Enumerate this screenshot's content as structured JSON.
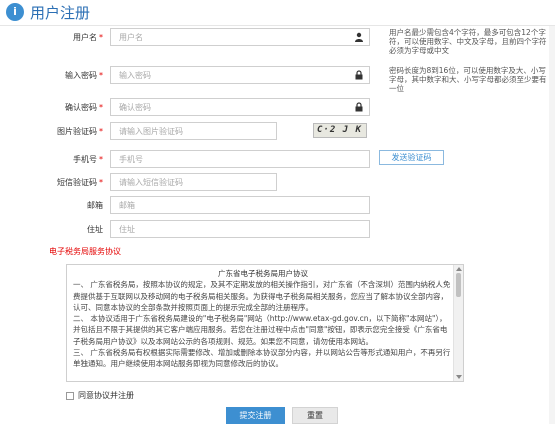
{
  "header": {
    "title": "用户注册",
    "logo_char": "i"
  },
  "fields": {
    "username": {
      "label": "用户名",
      "placeholder": "用户名",
      "required": "*"
    },
    "password": {
      "label": "输入密码",
      "placeholder": "输入密码",
      "required": "*"
    },
    "confirm": {
      "label": "确认密码",
      "placeholder": "确认密码",
      "required": "*"
    },
    "captcha": {
      "label": "图片验证码",
      "placeholder": "请输入图片验证码",
      "required": "*",
      "image_text": "C·2 J K"
    },
    "phone": {
      "label": "手机号",
      "placeholder": "手机号",
      "required": "*"
    },
    "sms": {
      "label": "短信验证码",
      "placeholder": "请输入短信验证码",
      "required": "*"
    },
    "email": {
      "label": "邮箱",
      "placeholder": "邮箱"
    },
    "address": {
      "label": "住址",
      "placeholder": "住址"
    }
  },
  "hints": {
    "username": "用户名最少需包含4个字符，最多可包含12个字符，可以使用数字、中文及字母，且前四个字符必须为字母或中文",
    "password": "密码长度为8到16位，可以使用数字及大、小写字母，其中数字和大、小写字母都必须至少要有一位"
  },
  "sms_button": "发送验证码",
  "agreement": {
    "section_title": "电子税务局服务协议",
    "doc_title": "广东省电子税务局用户协议",
    "paragraphs": [
      "一、 广东省税务局，按照本协议的规定，及其不定期发放的相关操作指引，对广东省（不含深圳）范围内纳税人免费提供基于互联网以及移动网的电子税务局相关服务。为获得电子税务局相关服务，您应当了解本协议全部内容，认可、同意本协议的全部条款并按照页面上的提示完成全部的注册程序。",
      "二、 本协议适用于广东省税务局建设的\"电子税务局\"网站（http://www.etax-gd.gov.cn，以下简称\"本网站\"），并包括且不限于其提供的其它客户端应用服务。若您在注册过程中点击\"同意\"按钮，即表示您完全接受《广东省电子税务局用户协议》以及本网站公示的各项规则、规范。如果您不同意，请勿使用本网站。",
      "三、 广东省税务局有权根据实际需要修改、增加或删除本协议部分内容，并以网站公告等形式通知用户，不再另行单独通知。用户继续使用本网站服务即视为同意修改后的协议。"
    ],
    "check_label": "同意协议并注册"
  },
  "buttons": {
    "submit": "提交注册",
    "reset": "重置"
  },
  "colors": {
    "accent": "#3d8fd1",
    "required": "#e40000",
    "title": "#2b6fb4"
  }
}
